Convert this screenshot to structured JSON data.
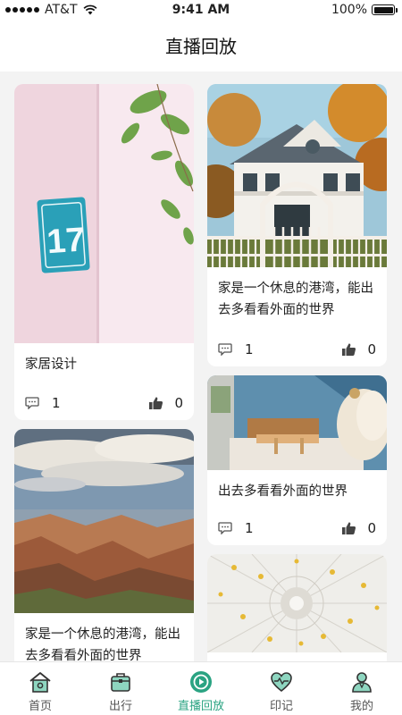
{
  "status_bar": {
    "carrier": "AT&T",
    "time": "9:41 AM",
    "battery": "100%"
  },
  "header": {
    "title": "直播回放"
  },
  "cards": [
    {
      "title": "家居设计",
      "comments": "1",
      "likes": "0"
    },
    {
      "title": "家是一个休息的港湾，能出去多看看外面的世界",
      "comments": "1",
      "likes": "0"
    },
    {
      "title": "出去多看看外面的世界",
      "comments": "1",
      "likes": "0"
    },
    {
      "title": "家是一个休息的港湾，能出去多看看外面的世界",
      "comments": "",
      "likes": ""
    },
    {
      "title": "",
      "comments": "",
      "likes": ""
    }
  ],
  "tabbar": {
    "items": [
      {
        "label": "首页",
        "icon": "home-icon"
      },
      {
        "label": "出行",
        "icon": "suitcase-icon"
      },
      {
        "label": "直播回放",
        "icon": "replay-icon"
      },
      {
        "label": "印记",
        "icon": "heart-pulse-icon"
      },
      {
        "label": "我的",
        "icon": "person-icon"
      }
    ],
    "active": "直播回放",
    "accent_color": "#2aa382"
  }
}
